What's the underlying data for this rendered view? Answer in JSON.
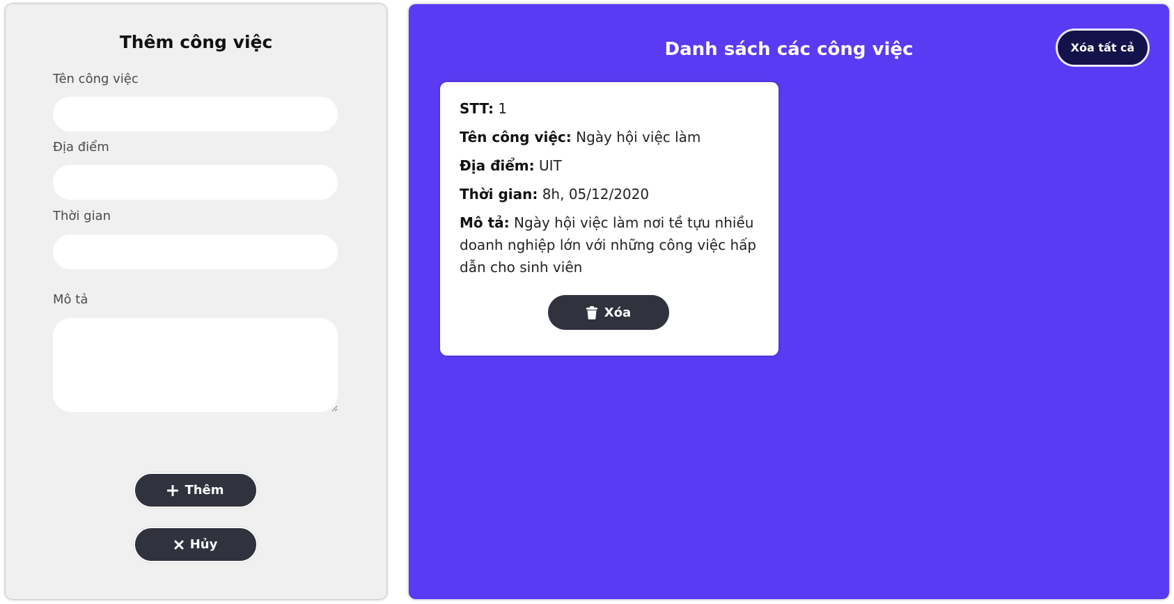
{
  "form": {
    "title": "Thêm công việc",
    "fields": [
      {
        "label": "Tên công việc",
        "value": "",
        "placeholder": ""
      },
      {
        "label": "Địa điểm",
        "value": "",
        "placeholder": ""
      },
      {
        "label": "Thời gian",
        "value": "",
        "placeholder": ""
      },
      {
        "label": "Mô tả",
        "value": "",
        "placeholder": ""
      }
    ],
    "add_label": "Thêm",
    "cancel_label": "Hủy"
  },
  "list": {
    "title": "Danh sách các công việc",
    "clear_all_label": "Xóa tất cả",
    "jobs": [
      {
        "stt_label": "STT:",
        "stt": "1",
        "name_label": "Tên công việc:",
        "name": "Ngày hội việc làm",
        "location_label": "Địa điểm:",
        "location": "UIT",
        "time_label": "Thời gian:",
        "time": "8h, 05/12/2020",
        "description_label": "Mô tả:",
        "description": "Ngày hội việc làm nơi tề tựu nhiều doanh nghiệp lớn với những công việc hấp dẫn cho sinh viên",
        "delete_label": "Xóa"
      }
    ]
  },
  "colors": {
    "accent": "#593bf3",
    "button_dark": "#30323d",
    "clear_button": "#14124a",
    "form_bg": "#f0f0f0"
  },
  "icons": {
    "add": "plus-icon",
    "cancel": "close-icon",
    "delete": "trash-icon"
  }
}
